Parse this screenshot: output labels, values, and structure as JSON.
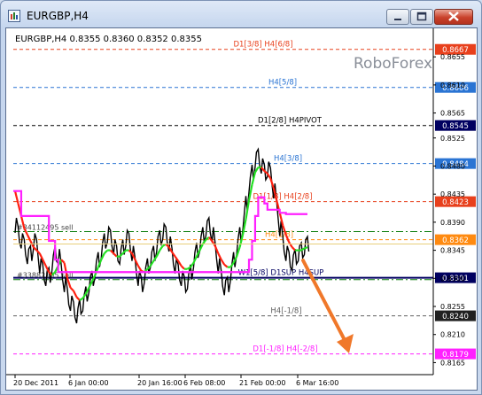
{
  "window": {
    "title": "EURGBP,H4"
  },
  "info": "EURGBP,H4  0.8355 0.8360 0.8352 0.8355",
  "watermark": "RoboForex",
  "colors": {
    "red": "#e8401c",
    "blue": "#2a74d3",
    "black": "#000000",
    "navy": "#000060",
    "orange": "#ff8a10",
    "green": "#0a7d0a",
    "magenta": "#ff20ff",
    "grey": "#606060",
    "priceLine": "#e8cf7a",
    "arrow": "#f0782a"
  },
  "levels": [
    {
      "price": 0.8667,
      "label": "D1[3/8] H4[6/8]",
      "box": "0.8667",
      "color": "#e8401c",
      "dash": "4,3",
      "boxBg": "#e8401c"
    },
    {
      "price": 0.8606,
      "label": "H4[5/8]",
      "box": "0.8606",
      "color": "#2a74d3",
      "dash": "4,3",
      "boxBg": "#2a74d3"
    },
    {
      "price": 0.8545,
      "label": "D1[2/8] H4PIVOT",
      "box": "0.8545",
      "color": "#000000",
      "dash": "4,3",
      "boxBg": "#000060"
    },
    {
      "price": 0.8484,
      "label": "H4[3/8]",
      "box": "0.8484",
      "color": "#2a74d3",
      "dash": "4,3",
      "boxBg": "#2a74d3"
    },
    {
      "price": 0.8423,
      "label": "D1[1/8] H4[2/8]",
      "box": "0.8423",
      "color": "#e8401c",
      "dash": "4,3",
      "boxBg": "#e8401c"
    },
    {
      "price": 0.8362,
      "label": "H4[1/8]",
      "box": "0.8362",
      "color": "#ff8a10",
      "dash": "4,3",
      "boxBg": "#ff8a10"
    },
    {
      "price": 0.8301,
      "label": "W1[5/8] D1SUP H4SUP",
      "box": "0.8301",
      "color": "#000060",
      "dash": "",
      "boxBg": "#000060"
    },
    {
      "price": 0.824,
      "label": "H4[-1/8]",
      "box": "0.8240",
      "color": "#606060",
      "dash": "4,3",
      "boxBg": "#202020"
    },
    {
      "price": 0.8179,
      "label": "D1[-1/8] H4[-2/8]",
      "box": "0.8179",
      "color": "#ff20ff",
      "dash": "4,3",
      "boxBg": "#ff20ff"
    }
  ],
  "green_levels": [
    {
      "price": 0.8375,
      "label": "#34112495 sell"
    },
    {
      "price": 0.8298,
      "label": "#33882105 sell"
    }
  ],
  "axis_ticks": [
    "0.8655",
    "0.8610",
    "0.8565",
    "0.8525",
    "0.8480",
    "0.8435",
    "0.8390",
    "0.8345",
    "0.8300",
    "0.8255",
    "0.8210",
    "0.8165"
  ],
  "axis_tick_values": [
    0.8655,
    0.861,
    0.8565,
    0.8525,
    0.848,
    0.8435,
    0.839,
    0.8345,
    0.83,
    0.8255,
    0.821,
    0.8165
  ],
  "time_labels": [
    "20 Dec 2011",
    "6 Jan 00:00",
    "20 Jan 16:00",
    "6 Feb 08:00",
    "21 Feb 00:00",
    "6 Mar 16:00"
  ],
  "chart_data": {
    "type": "line",
    "ylim": [
      0.815,
      0.8695
    ],
    "series": [
      {
        "values": [
          0.8385,
          0.837,
          0.836,
          0.835,
          0.8335,
          0.834,
          0.836,
          0.835,
          0.832,
          0.831,
          0.83,
          0.8305,
          0.8325,
          0.834,
          0.8335,
          0.831,
          0.829,
          0.827,
          0.826,
          0.825,
          0.824,
          0.8255,
          0.826,
          0.8275,
          0.829,
          0.83,
          0.8315,
          0.833,
          0.8345,
          0.836,
          0.837,
          0.8365,
          0.835,
          0.834,
          0.8335,
          0.835,
          0.8365,
          0.836,
          0.834,
          0.832,
          0.83,
          0.829,
          0.8305,
          0.832,
          0.833,
          0.834,
          0.8355,
          0.8365,
          0.8375,
          0.837,
          0.8355,
          0.8335,
          0.832,
          0.831,
          0.83,
          0.829,
          0.8295,
          0.831,
          0.833,
          0.8345,
          0.8355,
          0.837,
          0.838,
          0.8385,
          0.837,
          0.8345,
          0.832,
          0.83,
          0.8285,
          0.829,
          0.831,
          0.833,
          0.835,
          0.837,
          0.839,
          0.842,
          0.845,
          0.847,
          0.849,
          0.8495,
          0.848,
          0.847,
          0.8475,
          0.8465,
          0.844,
          0.841,
          0.838,
          0.8355,
          0.834,
          0.833,
          0.8325,
          0.8335,
          0.834,
          0.8345,
          0.835,
          0.8355
        ]
      },
      {
        "values": [
          0.844,
          0.842,
          0.84,
          0.838,
          0.837,
          0.836,
          0.835,
          0.8345,
          0.834,
          0.833,
          0.832,
          0.831,
          0.8305,
          0.831,
          0.832,
          0.833,
          0.8325,
          0.83,
          0.8285,
          0.828,
          0.827,
          0.8265,
          0.8268,
          0.8275,
          0.8285,
          0.8295,
          0.8305,
          0.8318,
          0.833,
          0.834,
          0.8345,
          0.8345,
          0.834,
          0.8335,
          0.8335,
          0.834,
          0.8345,
          0.8345,
          0.834,
          0.833,
          0.832,
          0.8312,
          0.831,
          0.8315,
          0.832,
          0.8328,
          0.8335,
          0.8345,
          0.8352,
          0.8355,
          0.835,
          0.8342,
          0.8335,
          0.8328,
          0.832,
          0.8315,
          0.8315,
          0.8318,
          0.8325,
          0.8335,
          0.8345,
          0.8355,
          0.8362,
          0.8366,
          0.836,
          0.8352,
          0.834,
          0.833,
          0.8322,
          0.8318,
          0.8318,
          0.8325,
          0.8335,
          0.835,
          0.837,
          0.8395,
          0.8425,
          0.845,
          0.847,
          0.8478,
          0.8478,
          0.8472,
          0.8468,
          0.846,
          0.8445,
          0.8425,
          0.8405,
          0.8385,
          0.837,
          0.8358,
          0.835,
          0.8345,
          0.8345,
          0.8345,
          0.8348,
          0.835
        ]
      },
      {
        "values": [
          0.844,
          0.844,
          0.84,
          0.84,
          0.84,
          0.84,
          0.84,
          0.84,
          0.84,
          0.84,
          0.84,
          0.836,
          0.836,
          0.833,
          0.831,
          0.831,
          0.831,
          0.831,
          0.831,
          0.831,
          0.831,
          0.831,
          0.831,
          0.831,
          0.831,
          0.831,
          0.831,
          0.831,
          0.831,
          0.831,
          0.831,
          0.831,
          0.831,
          0.831,
          0.831,
          0.831,
          0.831,
          0.831,
          0.831,
          0.831,
          0.831,
          0.831,
          0.831,
          0.831,
          0.831,
          0.831,
          0.831,
          0.831,
          0.831,
          0.831,
          0.831,
          0.831,
          0.831,
          0.831,
          0.831,
          0.831,
          0.831,
          0.831,
          0.831,
          0.831,
          0.831,
          0.831,
          0.831,
          0.831,
          0.831,
          0.831,
          0.831,
          0.831,
          0.831,
          0.831,
          0.831,
          0.831,
          0.831,
          0.831,
          0.831,
          0.831,
          0.833,
          0.836,
          0.84,
          0.843,
          0.843,
          0.842,
          0.841,
          0.841,
          0.841,
          0.841,
          0.8405,
          0.8405,
          0.8403,
          0.8403,
          0.8403,
          0.8403,
          0.8403,
          0.8403,
          0.8403,
          0.8403
        ]
      }
    ]
  }
}
